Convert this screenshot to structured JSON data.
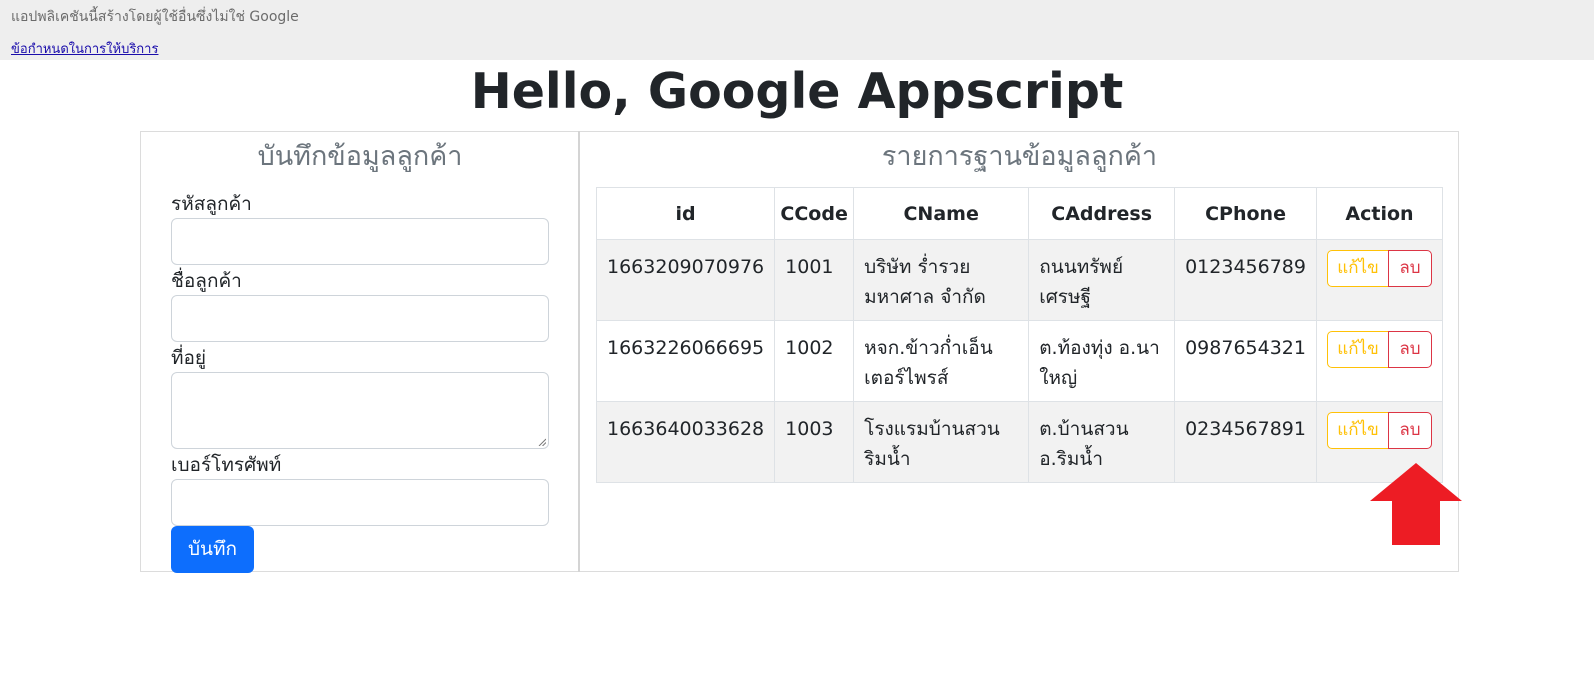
{
  "topbar": {
    "notice": "แอปพลิเคชันนี้สร้างโดยผู้ใช้อื่นซึ่งไม่ใช่ Google",
    "terms_link": "ข้อกำหนดในการให้บริการ"
  },
  "page_title": "Hello, Google Appscript",
  "form": {
    "title": "บันทึกข้อมูลลูกค้า",
    "code_label": "รหัสลูกค้า",
    "code_value": "",
    "name_label": "ชื่อลูกค้า",
    "name_value": "",
    "address_label": "ที่อยู่",
    "address_value": "",
    "phone_label": "เบอร์โทรศัพท์",
    "phone_value": "",
    "save_label": "บันทึก"
  },
  "list": {
    "title": "รายการฐานข้อมูลลูกค้า",
    "columns": [
      "id",
      "CCode",
      "CName",
      "CAddress",
      "CPhone",
      "Action"
    ],
    "rows": [
      {
        "id": "1663209070976",
        "ccode": "1001",
        "cname": "บริษัท ร่ำรวย มหาศาล จำกัด",
        "caddress": "ถนนทรัพย์ เศรษฐี",
        "cphone": "0123456789"
      },
      {
        "id": "1663226066695",
        "ccode": "1002",
        "cname": "หจก.ข้าวก่ำเอ็นเตอร์ไพรส์",
        "caddress": "ต.ท้องทุ่ง อ.นาใหญ่",
        "cphone": "0987654321"
      },
      {
        "id": "1663640033628",
        "ccode": "1003",
        "cname": "โรงแรมบ้านสวนริมน้ำ",
        "caddress": "ต.บ้านสวน อ.ริมน้ำ",
        "cphone": "0234567891"
      }
    ],
    "edit_label": "แก้ไข",
    "delete_label": "ลบ"
  },
  "colors": {
    "primary": "#0d6efd",
    "warning": "#ffc107",
    "danger": "#dc3545",
    "annotation_arrow": "#ed1c24"
  },
  "annotation": {
    "icon": "red-up-arrow-icon"
  }
}
